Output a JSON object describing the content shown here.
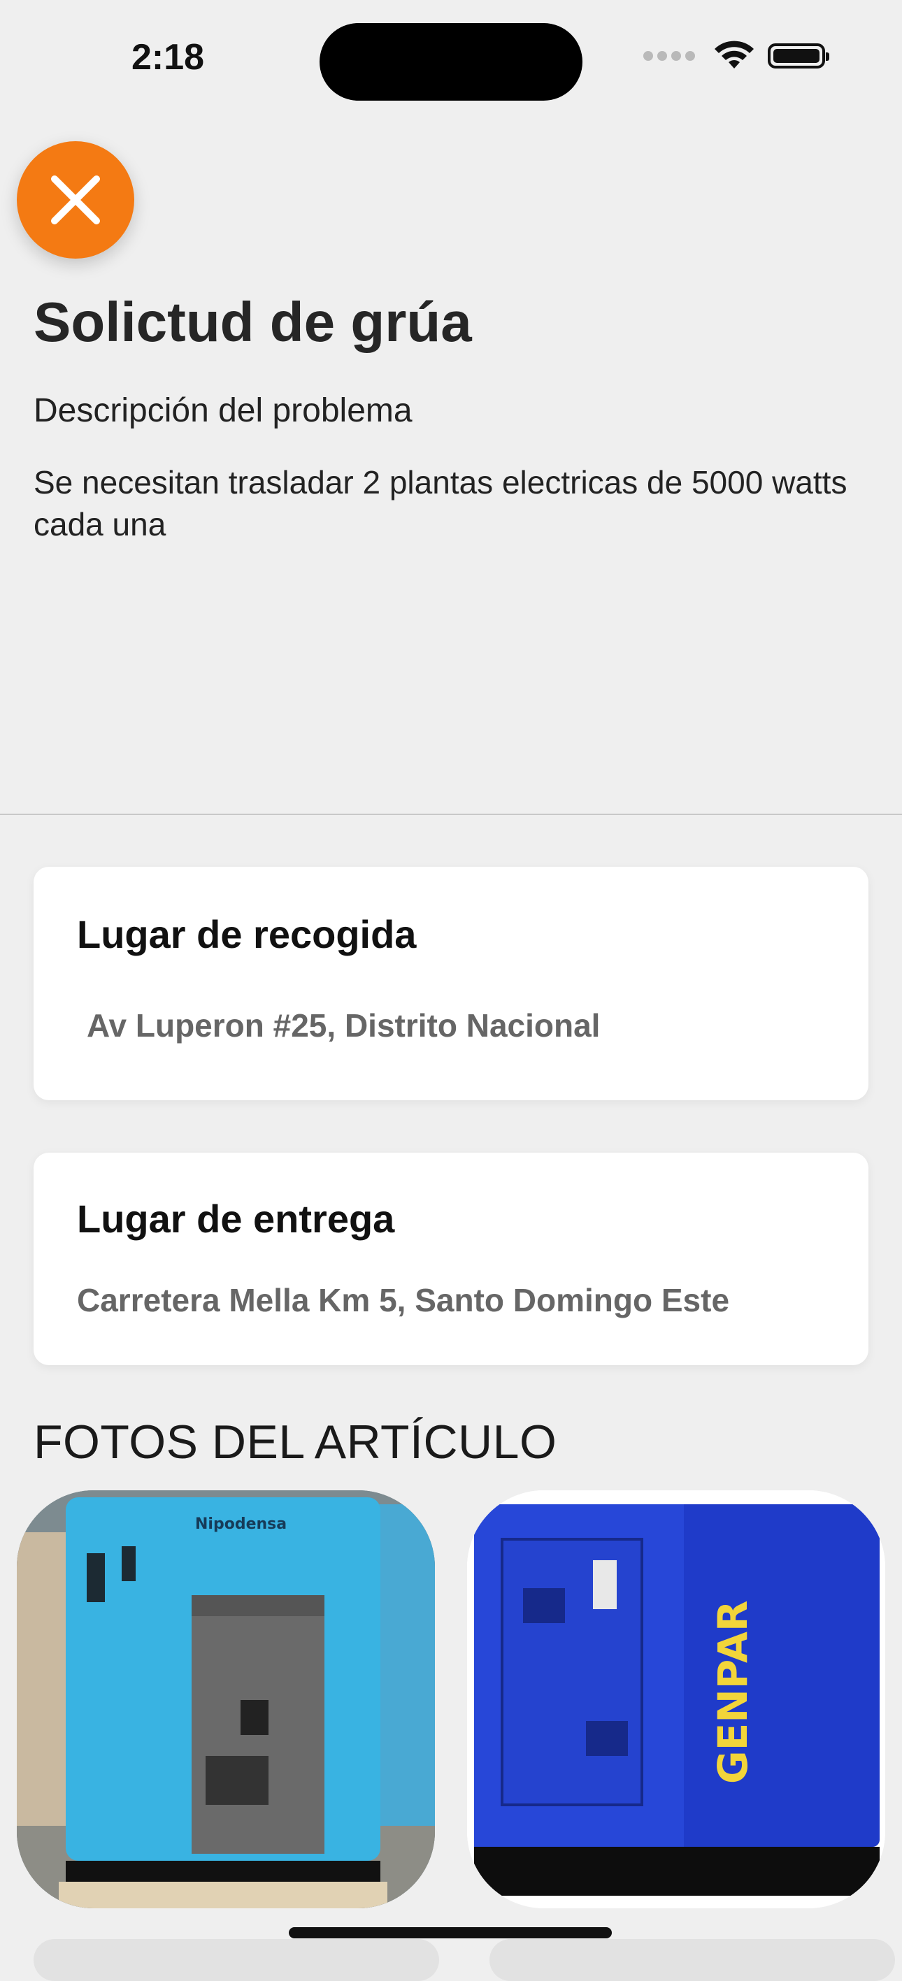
{
  "status_bar": {
    "time": "2:18"
  },
  "header": {
    "title": "Solictud de grúa",
    "description_label": "Descripción del problema",
    "description_text": "Se necesitan trasladar 2 plantas electricas de 5000 watts cada una"
  },
  "pickup": {
    "title": "Lugar de recogida",
    "value": "Av Luperon #25, Distrito Nacional"
  },
  "delivery": {
    "title": "Lugar de entrega",
    "value": "Carretera Mella Km 5, Santo Domingo Este"
  },
  "photos": {
    "heading": "FOTOS DEL ARTÍCULO",
    "items": [
      {
        "brand_text": "Nipodensa"
      },
      {
        "brand_text": "GENPAR"
      }
    ]
  },
  "colors": {
    "accent": "#f47a13",
    "background": "#efefef",
    "card": "#ffffff"
  }
}
